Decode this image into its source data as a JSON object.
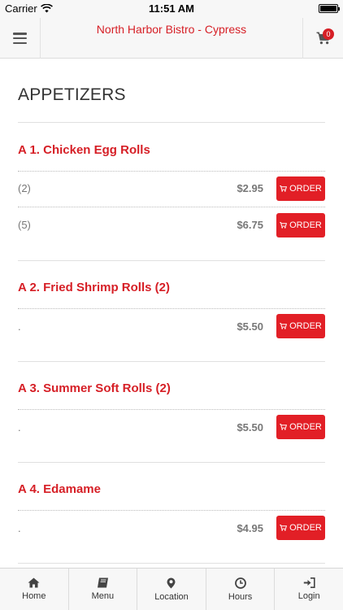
{
  "status_bar": {
    "carrier": "Carrier",
    "time": "11:51 AM",
    "battery_level": 1.0
  },
  "header": {
    "title": "North Harbor Bistro - Cypress",
    "menu_icon": "hamburger-icon",
    "cart_icon": "shopping-cart-icon",
    "cart_count": "0"
  },
  "category": {
    "title": "APPETIZERS"
  },
  "items": [
    {
      "name": "A 1. Chicken Egg Rolls",
      "options": [
        {
          "label": "(2)",
          "price": "$2.95",
          "button": "ORDER"
        },
        {
          "label": "(5)",
          "price": "$6.75",
          "button": "ORDER"
        }
      ]
    },
    {
      "name": "A 2. Fried Shrimp Rolls (2)",
      "options": [
        {
          "label": ".",
          "price": "$5.50",
          "button": "ORDER"
        }
      ]
    },
    {
      "name": "A 3. Summer Soft Rolls (2)",
      "options": [
        {
          "label": ".",
          "price": "$5.50",
          "button": "ORDER"
        }
      ]
    },
    {
      "name": "A 4. Edamame",
      "options": [
        {
          "label": ".",
          "price": "$4.95",
          "button": "ORDER"
        }
      ]
    }
  ],
  "tabbar": [
    {
      "label": "Home",
      "icon": "home-icon"
    },
    {
      "label": "Menu",
      "icon": "book-icon"
    },
    {
      "label": "Location",
      "icon": "map-marker-icon"
    },
    {
      "label": "Hours",
      "icon": "clock-icon"
    },
    {
      "label": "Login",
      "icon": "sign-in-icon"
    }
  ],
  "colors": {
    "accent": "#d61f26",
    "button": "#e21f26",
    "bar_bg": "#f7f7f7"
  }
}
